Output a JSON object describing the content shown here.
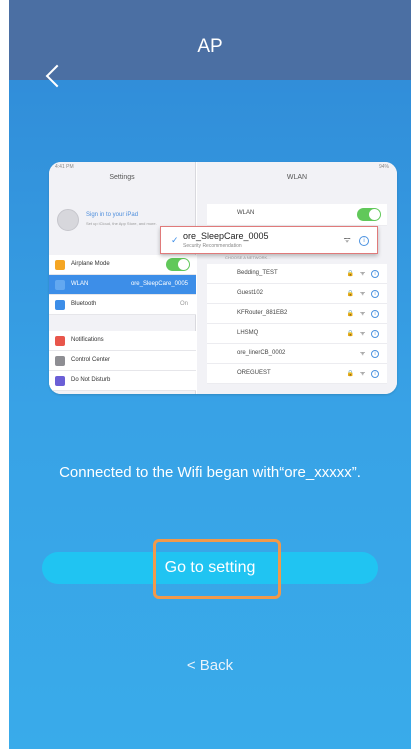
{
  "header": {
    "title": "AP",
    "back_icon": "chevron-left-icon"
  },
  "tutorial": {
    "status_left": "4:41 PM",
    "status_right": "94%",
    "left_pane": {
      "title": "Settings",
      "signin": "Sign in to your iPad",
      "signin_sub": "Set up iCloud, the App Store, and more.",
      "items": [
        {
          "label": "Airplane Mode",
          "value": "",
          "color": "#f5a623",
          "toggle": true
        },
        {
          "label": "WLAN",
          "value": "ore_SleepCare_0005",
          "color": "#3d8ee8",
          "selected": true
        },
        {
          "label": "Bluetooth",
          "value": "On",
          "color": "#3d8ee8"
        },
        {
          "label": "Notifications",
          "value": "",
          "color": "#e8564b"
        },
        {
          "label": "Control Center",
          "value": "",
          "color": "#8e8e93"
        },
        {
          "label": "Do Not Disturb",
          "value": "",
          "color": "#6b5fd6"
        }
      ]
    },
    "right_pane": {
      "title": "WLAN",
      "wlan_label": "WLAN",
      "connected_ssid": "ore_SleepCare_0005",
      "connected_sub": "Security Recommendation",
      "choose_label": "CHOOSE A NETWORK...",
      "networks": [
        "Bedding_TEST",
        "Guest102",
        "KFRouter_881EB2",
        "LHSMQ",
        "ore_linerCB_0002",
        "OREGUEST"
      ]
    }
  },
  "instruction": "Connected to the Wifi began with“ore_xxxxx”.",
  "buttons": {
    "go_to_setting": "Go to setting",
    "back": "< Back"
  },
  "colors": {
    "accent": "#20c4f2",
    "highlight": "#f2994a",
    "navbar": "#4b6fa3"
  }
}
